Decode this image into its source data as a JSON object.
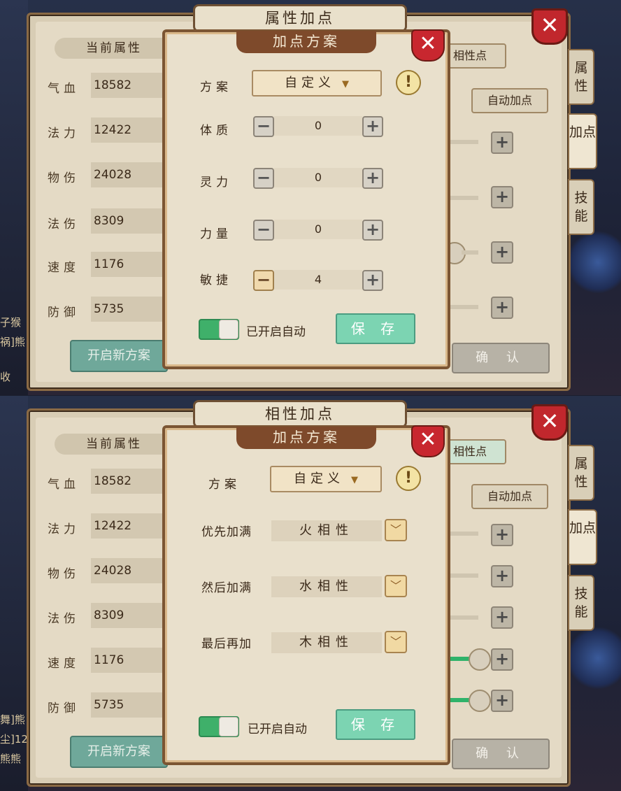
{
  "screens": [
    {
      "main_title": "属性加点",
      "current_attrs_label": "当前属性",
      "stats": [
        {
          "label": "气血",
          "value": "18582"
        },
        {
          "label": "法力",
          "value": "12422"
        },
        {
          "label": "物伤",
          "value": "24028"
        },
        {
          "label": "法伤",
          "value": "8309"
        },
        {
          "label": "速度",
          "value": "1176"
        },
        {
          "label": "防御",
          "value": "5735"
        }
      ],
      "new_plan_button": "开启新方案",
      "right_top_button": "相性点",
      "auto_assign_button": "自动加点",
      "confirm_button": "确 认",
      "side_tabs": [
        {
          "label": "属性",
          "active": false
        },
        {
          "label": "加点",
          "active": true
        },
        {
          "label": "技能",
          "active": false
        }
      ],
      "left_edge_text": [
        "子猴",
        "祸]熊",
        "收"
      ],
      "dialog": {
        "title": "加点方案",
        "plan_label": "方案",
        "plan_value": "自定义",
        "plan_arrow": "▼",
        "warn_icon_glyph": "!",
        "rows": [
          {
            "label": "体质",
            "value": "0"
          },
          {
            "label": "灵力",
            "value": "0"
          },
          {
            "label": "力量",
            "value": "0"
          },
          {
            "label": "敏捷",
            "value": "4"
          }
        ],
        "auto_label": "已开启自动",
        "save_button": "保 存"
      }
    },
    {
      "main_title": "相性加点",
      "current_attrs_label": "当前属性",
      "stats": [
        {
          "label": "气血",
          "value": "18582"
        },
        {
          "label": "法力",
          "value": "12422"
        },
        {
          "label": "物伤",
          "value": "24028"
        },
        {
          "label": "法伤",
          "value": "8309"
        },
        {
          "label": "速度",
          "value": "1176"
        },
        {
          "label": "防御",
          "value": "5735"
        }
      ],
      "new_plan_button": "开启新方案",
      "right_top_button": "相性点",
      "auto_assign_button": "自动加点",
      "confirm_button": "确 认",
      "side_tabs": [
        {
          "label": "属性",
          "active": false
        },
        {
          "label": "加点",
          "active": true
        },
        {
          "label": "技能",
          "active": false
        }
      ],
      "left_edge_text": [
        "舞]熊",
        "尘]12",
        "熊熊"
      ],
      "dialog": {
        "title": "加点方案",
        "plan_label": "方案",
        "plan_value": "自定义",
        "plan_arrow": "▼",
        "warn_icon_glyph": "!",
        "priority_rows": [
          {
            "label": "优先加满",
            "value": "火相性"
          },
          {
            "label": "然后加满",
            "value": "水相性"
          },
          {
            "label": "最后再加",
            "value": "木相性"
          }
        ],
        "auto_label": "已开启自动",
        "save_button": "保 存"
      }
    }
  ],
  "colors": {
    "accent_green": "#3fb06a",
    "save_teal": "#7cd4b2",
    "close_red": "#c8272f",
    "frame_brown": "#7b5533"
  },
  "icons": {
    "close": "close-icon",
    "warning": "warning-icon",
    "plus": "plus-icon",
    "minus": "minus-icon",
    "chevron": "chevron-down-icon"
  }
}
